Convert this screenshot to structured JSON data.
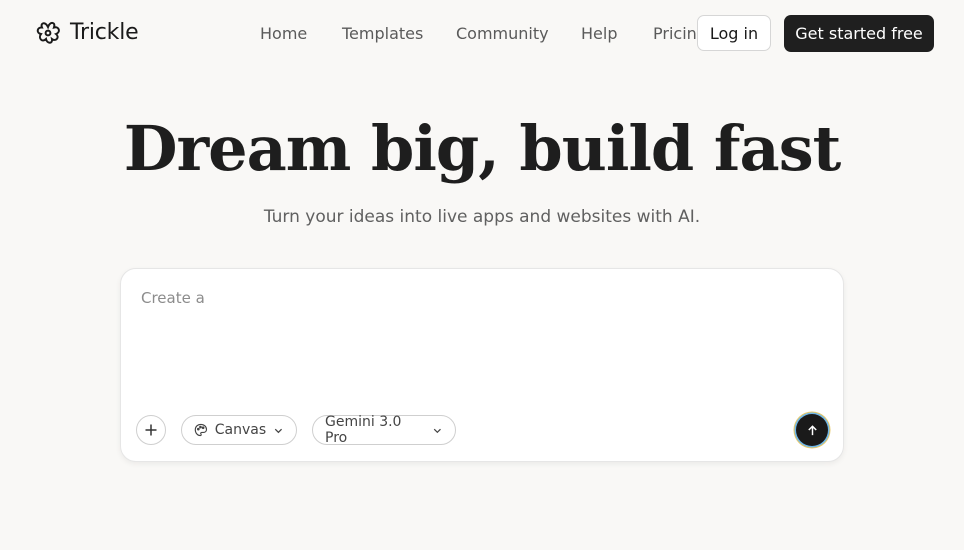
{
  "brand": {
    "name": "Trickle",
    "icon": "flower-logo-icon"
  },
  "nav": {
    "items": [
      {
        "label": "Home"
      },
      {
        "label": "Templates"
      },
      {
        "label": "Community"
      },
      {
        "label": "Help"
      },
      {
        "label": "Pricing"
      }
    ],
    "login_label": "Log in",
    "cta_label": "Get started free"
  },
  "hero": {
    "title": "Dream big, build fast",
    "subtitle": "Turn your ideas into live apps and websites with AI."
  },
  "prompt": {
    "placeholder": "Create a",
    "value": "",
    "attach_icon": "plus-icon",
    "mode_label": "Canvas",
    "mode_icon": "palette-icon",
    "model_label": "Gemini 3.0 Pro",
    "send_icon": "arrow-up-icon"
  },
  "colors": {
    "background": "#f9f8f6",
    "primary_button": "#1f1f1f",
    "text": "#1e1e1e"
  }
}
